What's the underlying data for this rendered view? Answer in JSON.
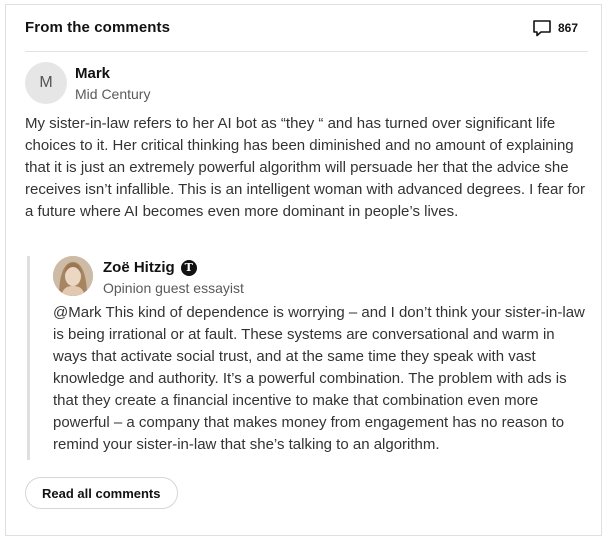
{
  "header": {
    "title": "From the comments",
    "comment_count": "867",
    "comment_icon": "speech-bubble-icon"
  },
  "comment": {
    "avatar_initial": "M",
    "author": "Mark",
    "location": "Mid Century",
    "body": "My sister-in-law refers to her AI bot as “they “ and has turned over significant life choices to it. Her critical thinking has been diminished and no amount of explaining that it is just an extremely powerful algorithm will persuade her that the advice she receives isn’t infallible. This is an intelligent woman with advanced degrees. I fear for a future where AI becomes even more dominant in people’s lives."
  },
  "reply": {
    "author": "Zoë Hitzig",
    "badge_glyph": "T",
    "role": "Opinion guest essayist",
    "body": "@Mark This kind of dependence is worrying – and I don’t think your sister-in-law is being irrational or at fault. These systems are conversational and warm in ways that activate social trust, and at the same time they speak with vast knowledge and authority. It’s a powerful combination. The problem with ads is that they create a financial incentive to make that combination even more powerful – a company that makes money from engagement has no reason to remind your sister-in-law that she’s talking to an algorithm."
  },
  "footer": {
    "read_all_label": "Read all comments"
  },
  "colors": {
    "text": "#121212",
    "body_text": "#333333",
    "muted": "#5a5a5a",
    "border": "#dfdfdf"
  }
}
